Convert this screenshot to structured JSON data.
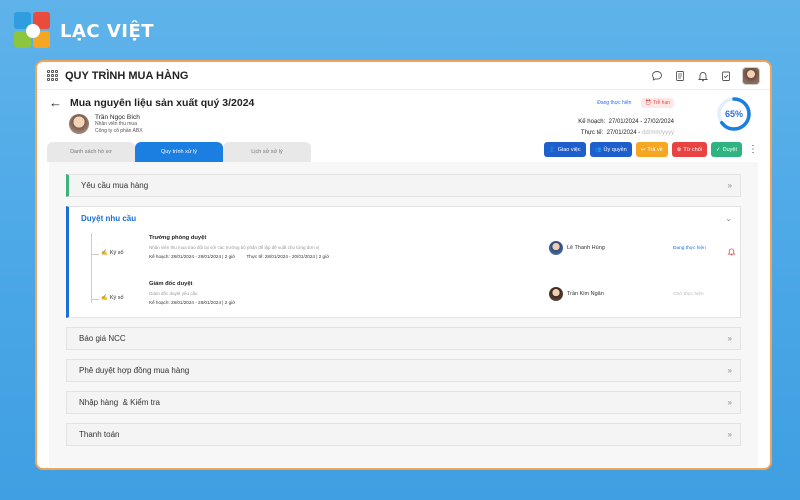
{
  "brand": {
    "name": "LẠC VIỆT",
    "colors": [
      "#e94b3c",
      "#2f9de0",
      "#8cc63f",
      "#f5a623"
    ]
  },
  "topbar": {
    "title": "QUY TRÌNH MUA HÀNG",
    "icons": [
      "chat-icon",
      "document-icon",
      "bell-icon",
      "clipboard-check-icon",
      "user-avatar"
    ]
  },
  "header": {
    "title": "Mua nguyên liệu sản xuất quý 3/2024",
    "owner": {
      "name": "Trần Ngọc Bích",
      "role": "Nhân viên thu mua",
      "company": "Công ty cổ phần ABX"
    },
    "status": "Đang thực hiện",
    "overdue": "Trễ hạn",
    "plan_label": "Kế hoạch:",
    "plan_value": "27/01/2024 - 27/02/2024",
    "actual_label": "Thực tế:",
    "actual_value": "27/01/2024 - ",
    "actual_placeholder": "dd/mm/yyyy",
    "progress": 65,
    "progress_text": "65%"
  },
  "tabs": [
    "Danh sách hồ sơ",
    "Quy trình xử lý",
    "Lịch sử xử lý"
  ],
  "actions": [
    {
      "label": "Giao việc",
      "color": "#1f5fcc"
    },
    {
      "label": "Ủy quyền",
      "color": "#1f5fcc"
    },
    {
      "label": "Trả về",
      "color": "#f5a623"
    },
    {
      "label": "Từ chối",
      "color": "#e84343"
    },
    {
      "label": "Duyệt",
      "color": "#2fb380"
    }
  ],
  "sections": {
    "s1": "Yêu cầu mua hàng",
    "s2": "Duyệt nhu cầu",
    "s3": "Báo giá NCC",
    "s4": "Phê duyệt hợp đồng mua hàng",
    "s5": "Nhập hàng  & Kiểm tra",
    "s6": "Thanh toán"
  },
  "steps": [
    {
      "action": "Ký số",
      "title": "Trưởng phòng duyệt",
      "desc": "Nhân viên thu mua trao đổi lại với các trưởng bộ phận để lập đề xuất cho từng đơn vị",
      "plan": "Kế hoạch: 28/01/2024 - 28/01/2024 | 2 giờ",
      "actual": "Thực tế: 28/01/2024 - 20/01/2024 | 2 giờ",
      "person": "Lê Thanh Hùng",
      "status": "Đang thực hiện"
    },
    {
      "action": "Ký số",
      "title": "Giám đốc duyệt",
      "desc": "Giám đốc duyệt yêu cầu",
      "plan": "Kế hoạch: 28/01/2024 - 28/01/2024 | 2 giờ",
      "person": "Trần Kim Ngân",
      "status": "Chờ thực hiện"
    }
  ]
}
